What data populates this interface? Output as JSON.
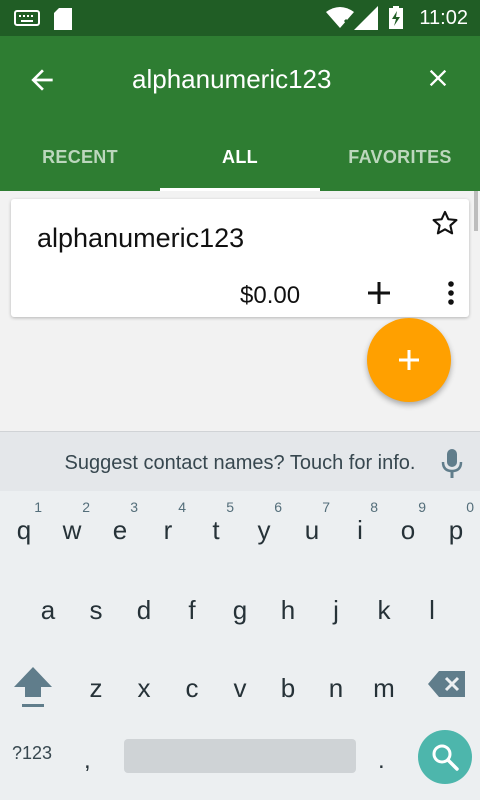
{
  "status": {
    "time": "11:02"
  },
  "appbar": {
    "search_text": "alphanumeric123"
  },
  "tabs": [
    {
      "label": "RECENT"
    },
    {
      "label": "ALL"
    },
    {
      "label": "FAVORITES"
    }
  ],
  "card": {
    "name": "alphanumeric123",
    "price": "$0.00"
  },
  "keyboard": {
    "suggestion": "Suggest contact names? Touch for info.",
    "row1": [
      {
        "k": "q",
        "h": "1"
      },
      {
        "k": "w",
        "h": "2"
      },
      {
        "k": "e",
        "h": "3"
      },
      {
        "k": "r",
        "h": "4"
      },
      {
        "k": "t",
        "h": "5"
      },
      {
        "k": "y",
        "h": "6"
      },
      {
        "k": "u",
        "h": "7"
      },
      {
        "k": "i",
        "h": "8"
      },
      {
        "k": "o",
        "h": "9"
      },
      {
        "k": "p",
        "h": "0"
      }
    ],
    "row2": [
      "a",
      "s",
      "d",
      "f",
      "g",
      "h",
      "j",
      "k",
      "l"
    ],
    "row3": [
      "z",
      "x",
      "c",
      "v",
      "b",
      "n",
      "m"
    ],
    "symbols_label": "?123",
    "comma": ",",
    "period": "."
  },
  "colors": {
    "appbar": "#2e7d32",
    "statusbar": "#205d25",
    "fab": "#ffa000",
    "search_key": "#4db6ac"
  },
  "icons": [
    "back-arrow-icon",
    "close-icon",
    "star-outline-icon",
    "plus-icon",
    "more-vert-icon",
    "mic-icon",
    "shift-icon",
    "backspace-icon",
    "search-icon"
  ]
}
